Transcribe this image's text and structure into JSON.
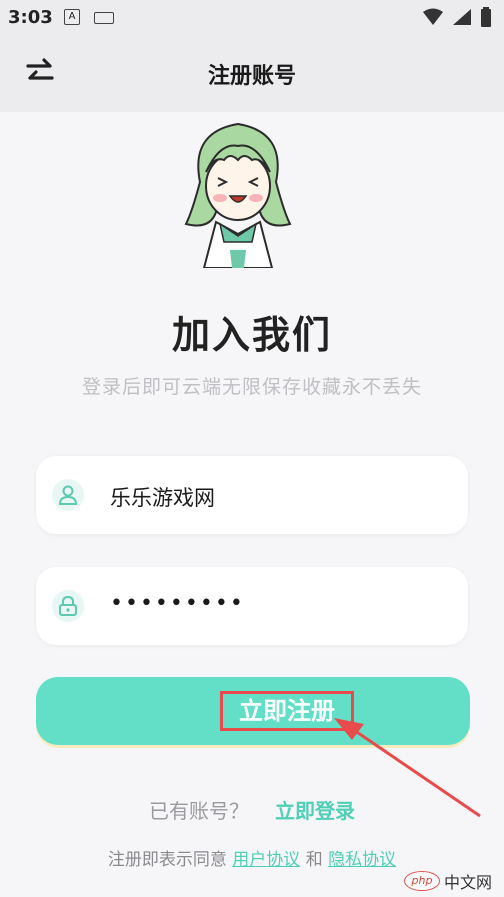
{
  "status": {
    "time": "3:03",
    "a_icon_text": "A"
  },
  "appbar": {
    "title": "注册账号"
  },
  "hero": {
    "title": "加入我们",
    "subtitle": "登录后即可云端无限保存收藏永不丢失"
  },
  "form": {
    "username": "乐乐游戏网",
    "password": "•••••••••"
  },
  "register_button": {
    "label": "立即注册"
  },
  "login_row": {
    "prompt": "已有账号？",
    "link": "立即登录"
  },
  "agreement": {
    "prefix": "注册即表示同意",
    "user_agreement": "用户协议",
    "and": "和",
    "privacy": "隐私协议"
  },
  "watermark": {
    "logo": "php",
    "text": "中文网"
  },
  "colors": {
    "accent": "#63dfc8",
    "link": "#4fcfb5",
    "highlight": "#e84b4b"
  }
}
